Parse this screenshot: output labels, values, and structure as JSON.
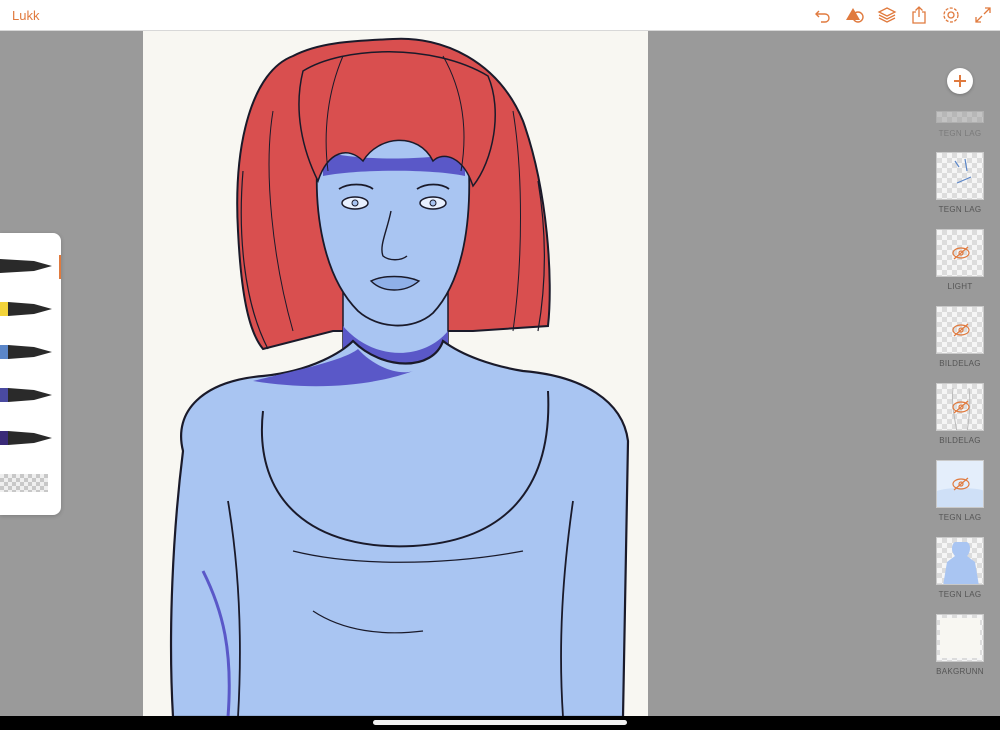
{
  "topbar": {
    "close_label": "Lukk",
    "accent": "#e07a3e",
    "icons": [
      "undo-icon",
      "shapes-icon",
      "layers-icon",
      "share-icon",
      "settings-icon",
      "fullscreen-icon"
    ]
  },
  "brushes": [
    {
      "name": "black-brush",
      "color": "#2a2a2a"
    },
    {
      "name": "yellow-brush",
      "color": "#f2d33a"
    },
    {
      "name": "blue-brush",
      "color": "#5b86c8"
    },
    {
      "name": "indigo-brush",
      "color": "#4a4aa0"
    },
    {
      "name": "violet-brush",
      "color": "#3a2a78"
    }
  ],
  "layers": [
    {
      "label": "TEGN LAG"
    },
    {
      "label": "TEGN LAG"
    },
    {
      "label": "LIGHT"
    },
    {
      "label": "BILDELAG"
    },
    {
      "label": "BILDELAG"
    },
    {
      "label": "TEGN LAG"
    },
    {
      "label": "TEGN LAG"
    },
    {
      "label": "BAKGRUNN"
    }
  ],
  "artwork": {
    "hair_color": "#d94f4f",
    "skin_color": "#a9c5f2",
    "shadow_color": "#5a58c8",
    "line_color": "#1a1a2a",
    "background": "#f8f7f2"
  }
}
